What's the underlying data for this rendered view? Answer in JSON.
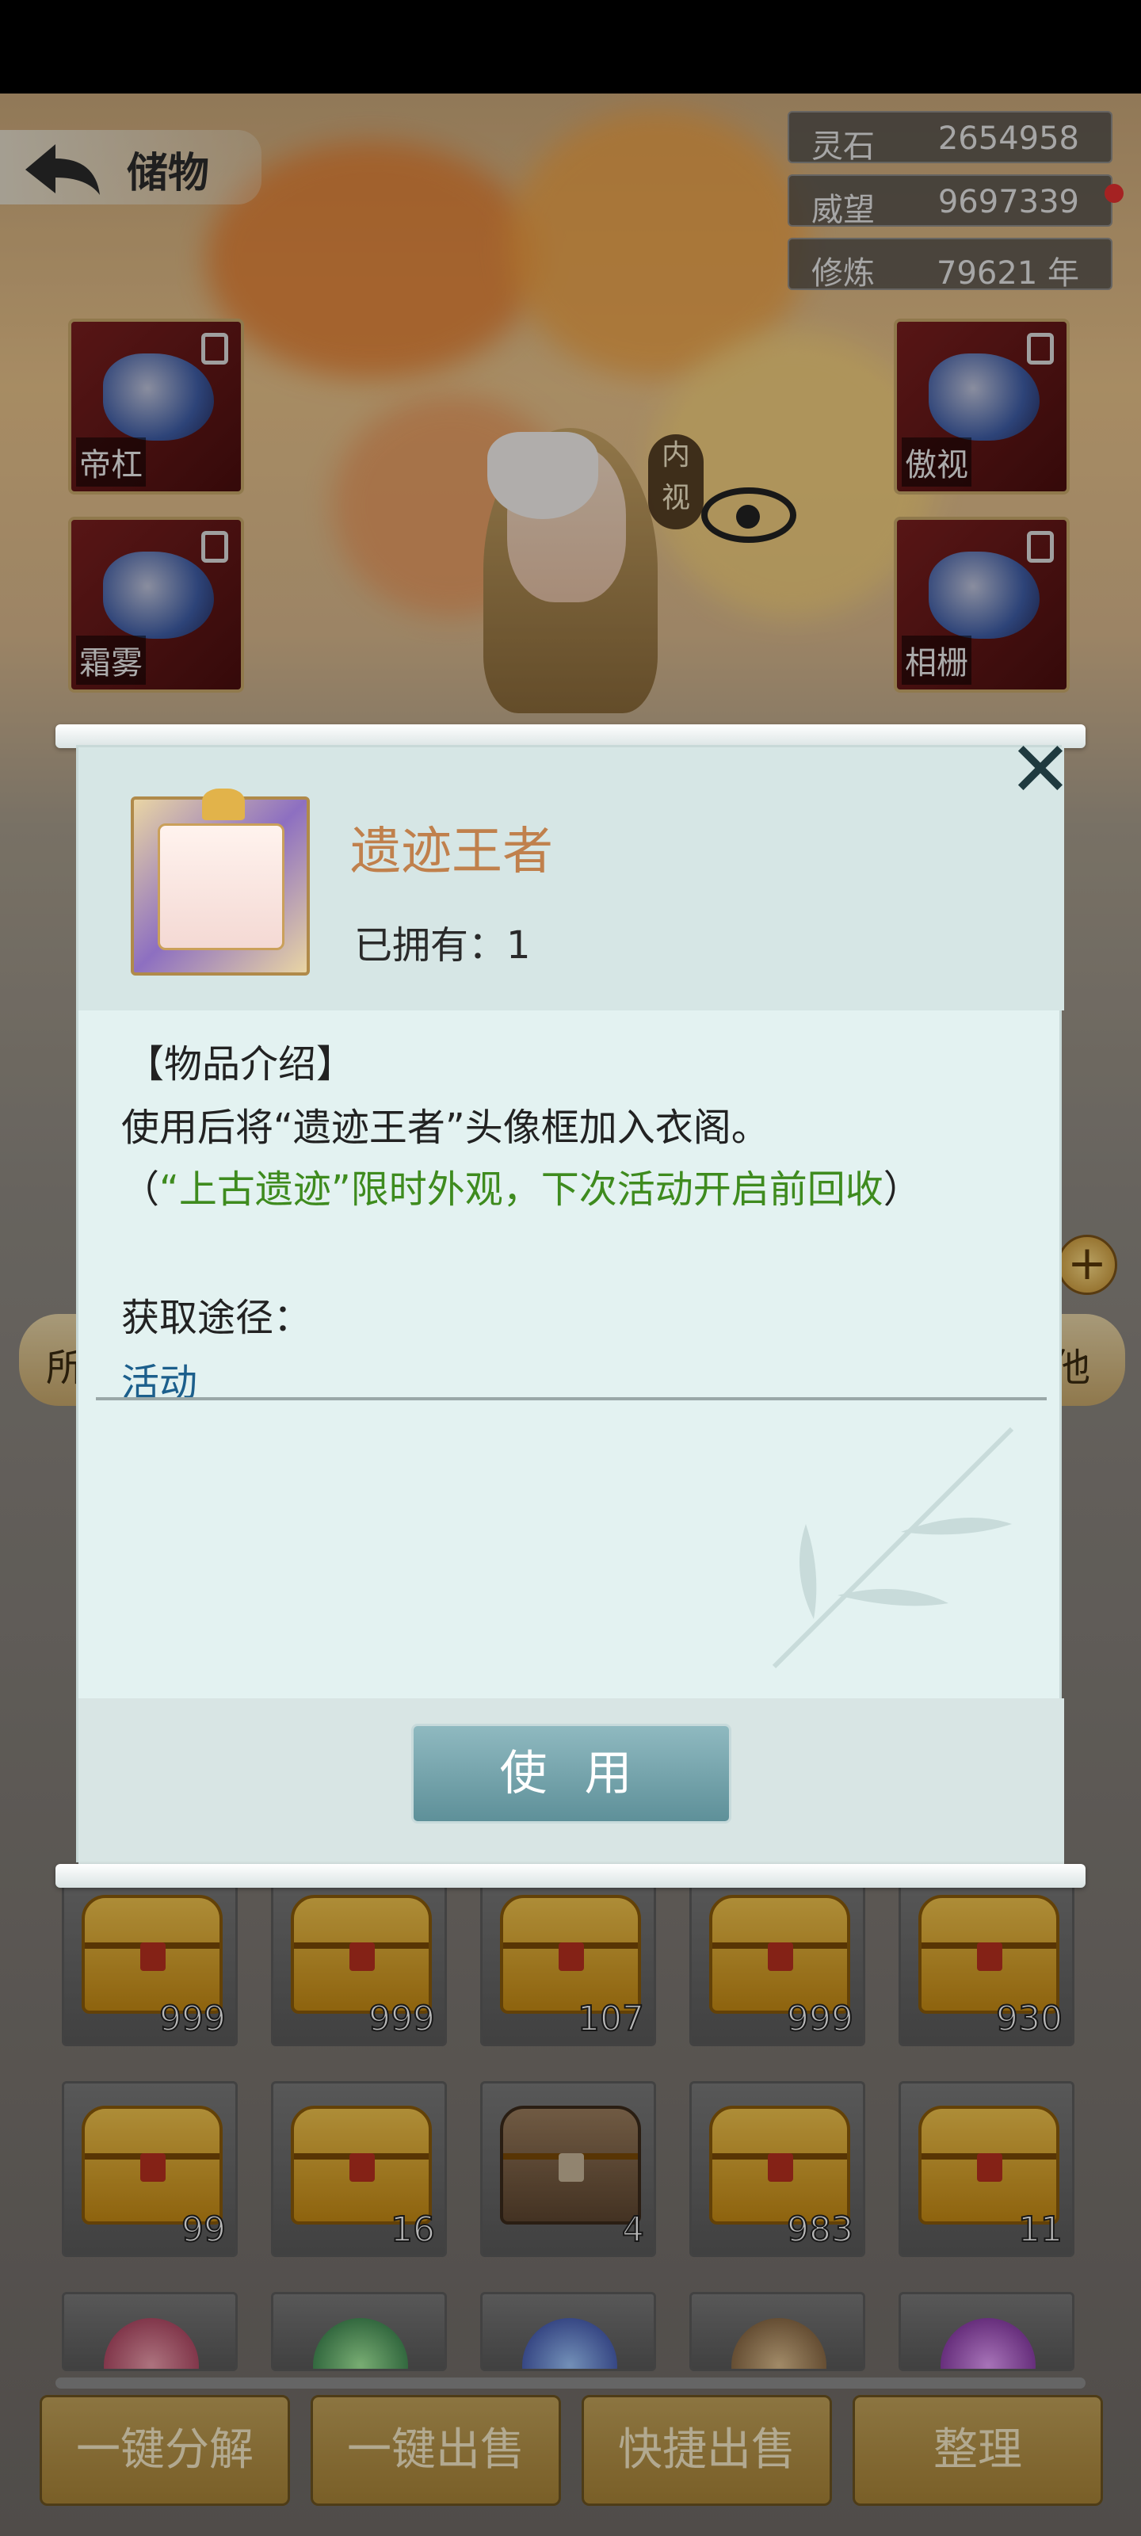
{
  "header": {
    "title": "储物",
    "stats": [
      {
        "label": "灵石",
        "value": "2654958"
      },
      {
        "label": "威望",
        "value": "9697339"
      },
      {
        "label": "修炼",
        "value": "79621 年"
      }
    ]
  },
  "equipment": {
    "left": [
      {
        "seal": "帝杠"
      },
      {
        "seal": "霜雾"
      }
    ],
    "right": [
      {
        "seal": "傲视"
      },
      {
        "seal": "相栅"
      }
    ],
    "inner_view_label": "内视"
  },
  "side_tabs": {
    "left": "所",
    "right": "他"
  },
  "inventory": {
    "row1": [
      {
        "type": "gold-chest",
        "count": "999"
      },
      {
        "type": "gold-chest",
        "count": "999"
      },
      {
        "type": "gold-chest",
        "count": "107"
      },
      {
        "type": "gold-chest",
        "count": "999"
      },
      {
        "type": "gold-chest",
        "count": "930"
      }
    ],
    "row2": [
      {
        "type": "gold-chest",
        "count": "99"
      },
      {
        "type": "gold-chest",
        "count": "16"
      },
      {
        "type": "wood-chest",
        "count": "4"
      },
      {
        "type": "gold-chest",
        "count": "983"
      },
      {
        "type": "gold-chest",
        "count": "11"
      }
    ]
  },
  "bottom_bar": {
    "decompose": "一键分解",
    "sell": "一键出售",
    "quick_sell": "快捷出售",
    "sort": "整理"
  },
  "dialog": {
    "item_name": "遗迹王者",
    "owned": "已拥有：1",
    "intro_title": "【物品介绍】",
    "description": "使用后将“遗迹王者”头像框加入衣阁。",
    "note_open": "（",
    "note_green": "“上古遗迹”限时外观，下次活动开启前回收",
    "note_close": "）",
    "source_label": "获取途径：",
    "source_value": "活动",
    "use_button": "使 用"
  },
  "colors": {
    "item_name": "#c0804c",
    "note_green": "#3e8b1e",
    "source_link": "#1c5f8c",
    "use_button": "#6f9ea6",
    "bottom_button": "#b8954a"
  }
}
